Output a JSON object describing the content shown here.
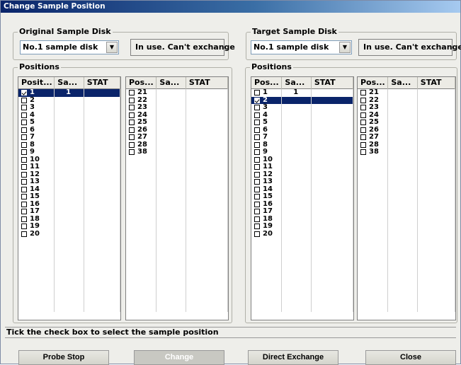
{
  "window": {
    "title": "Change Sample Position"
  },
  "original": {
    "group_label": "Original Sample Disk",
    "disk_select": "No.1 sample disk",
    "status": "In use. Can't exchange",
    "positions_label": "Positions",
    "table1": {
      "headers": [
        "Posit...",
        "Sa...",
        "STAT"
      ],
      "rows": [
        {
          "pos": "1",
          "sample": "1",
          "stat": "",
          "checked": true,
          "selected": true
        },
        {
          "pos": "2",
          "sample": "",
          "stat": ""
        },
        {
          "pos": "3",
          "sample": "",
          "stat": ""
        },
        {
          "pos": "4",
          "sample": "",
          "stat": ""
        },
        {
          "pos": "5",
          "sample": "",
          "stat": ""
        },
        {
          "pos": "6",
          "sample": "",
          "stat": ""
        },
        {
          "pos": "7",
          "sample": "",
          "stat": ""
        },
        {
          "pos": "8",
          "sample": "",
          "stat": ""
        },
        {
          "pos": "9",
          "sample": "",
          "stat": ""
        },
        {
          "pos": "10",
          "sample": "",
          "stat": ""
        },
        {
          "pos": "11",
          "sample": "",
          "stat": ""
        },
        {
          "pos": "12",
          "sample": "",
          "stat": ""
        },
        {
          "pos": "13",
          "sample": "",
          "stat": ""
        },
        {
          "pos": "14",
          "sample": "",
          "stat": ""
        },
        {
          "pos": "15",
          "sample": "",
          "stat": ""
        },
        {
          "pos": "16",
          "sample": "",
          "stat": ""
        },
        {
          "pos": "17",
          "sample": "",
          "stat": ""
        },
        {
          "pos": "18",
          "sample": "",
          "stat": ""
        },
        {
          "pos": "19",
          "sample": "",
          "stat": ""
        },
        {
          "pos": "20",
          "sample": "",
          "stat": ""
        }
      ]
    },
    "table2": {
      "headers": [
        "Pos...",
        "Sa...",
        "STAT"
      ],
      "rows": [
        {
          "pos": "21",
          "sample": "",
          "stat": ""
        },
        {
          "pos": "22",
          "sample": "",
          "stat": ""
        },
        {
          "pos": "23",
          "sample": "",
          "stat": ""
        },
        {
          "pos": "24",
          "sample": "",
          "stat": ""
        },
        {
          "pos": "25",
          "sample": "",
          "stat": ""
        },
        {
          "pos": "26",
          "sample": "",
          "stat": ""
        },
        {
          "pos": "27",
          "sample": "",
          "stat": ""
        },
        {
          "pos": "28",
          "sample": "",
          "stat": ""
        },
        {
          "pos": "38",
          "sample": "",
          "stat": ""
        }
      ]
    }
  },
  "target": {
    "group_label": "Target Sample Disk",
    "disk_select": "No.1 sample disk",
    "status": "In use. Can't exchange",
    "positions_label": "Positions",
    "table1": {
      "headers": [
        "Pos...",
        "Sa...",
        "STAT"
      ],
      "rows": [
        {
          "pos": "1",
          "sample": "1",
          "stat": ""
        },
        {
          "pos": "2",
          "sample": "",
          "stat": "",
          "checked": true,
          "selected": true
        },
        {
          "pos": "3",
          "sample": "",
          "stat": ""
        },
        {
          "pos": "4",
          "sample": "",
          "stat": ""
        },
        {
          "pos": "5",
          "sample": "",
          "stat": ""
        },
        {
          "pos": "6",
          "sample": "",
          "stat": ""
        },
        {
          "pos": "7",
          "sample": "",
          "stat": ""
        },
        {
          "pos": "8",
          "sample": "",
          "stat": ""
        },
        {
          "pos": "9",
          "sample": "",
          "stat": ""
        },
        {
          "pos": "10",
          "sample": "",
          "stat": ""
        },
        {
          "pos": "11",
          "sample": "",
          "stat": ""
        },
        {
          "pos": "12",
          "sample": "",
          "stat": ""
        },
        {
          "pos": "13",
          "sample": "",
          "stat": ""
        },
        {
          "pos": "14",
          "sample": "",
          "stat": ""
        },
        {
          "pos": "15",
          "sample": "",
          "stat": ""
        },
        {
          "pos": "16",
          "sample": "",
          "stat": ""
        },
        {
          "pos": "17",
          "sample": "",
          "stat": ""
        },
        {
          "pos": "18",
          "sample": "",
          "stat": ""
        },
        {
          "pos": "19",
          "sample": "",
          "stat": ""
        },
        {
          "pos": "20",
          "sample": "",
          "stat": ""
        }
      ]
    },
    "table2": {
      "headers": [
        "Pos...",
        "Sa...",
        "STAT"
      ],
      "rows": [
        {
          "pos": "21",
          "sample": "",
          "stat": ""
        },
        {
          "pos": "22",
          "sample": "",
          "stat": ""
        },
        {
          "pos": "23",
          "sample": "",
          "stat": ""
        },
        {
          "pos": "24",
          "sample": "",
          "stat": ""
        },
        {
          "pos": "25",
          "sample": "",
          "stat": ""
        },
        {
          "pos": "26",
          "sample": "",
          "stat": ""
        },
        {
          "pos": "27",
          "sample": "",
          "stat": ""
        },
        {
          "pos": "28",
          "sample": "",
          "stat": ""
        },
        {
          "pos": "38",
          "sample": "",
          "stat": ""
        }
      ]
    }
  },
  "hint": "Tick the check box to select the sample position",
  "buttons": {
    "probe_stop": "Probe Stop",
    "change": "Change",
    "direct_exchange": "Direct Exchange",
    "close": "Close"
  },
  "colors": {
    "selection": "#0a246a",
    "dialog_bg": "#eeeeea"
  }
}
